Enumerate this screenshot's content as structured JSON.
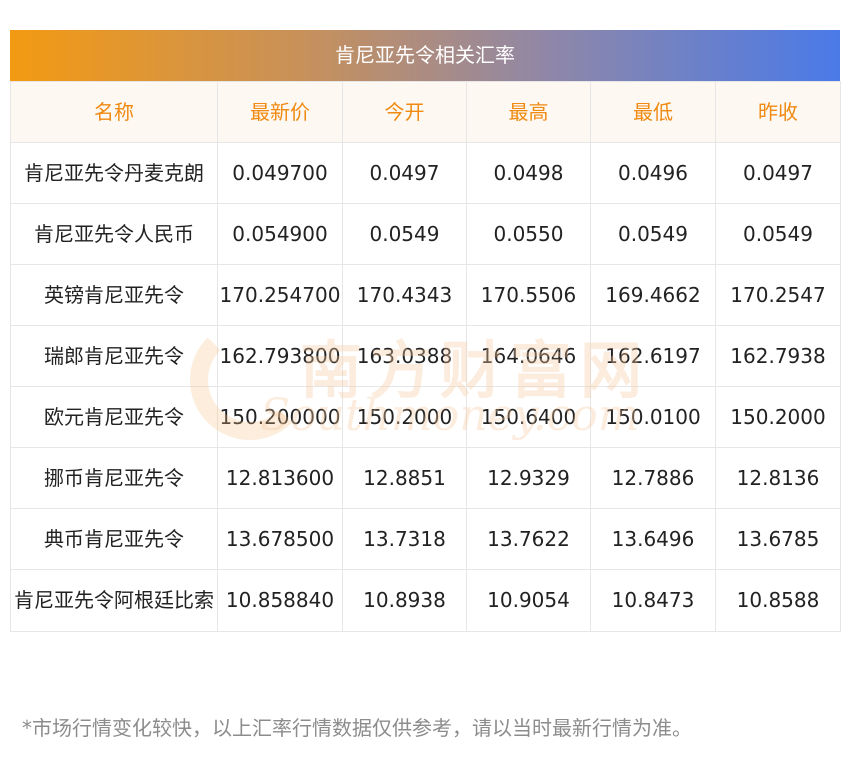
{
  "title": "肯尼亚先令相关汇率",
  "headers": [
    "名称",
    "最新价",
    "今开",
    "最高",
    "最低",
    "昨收"
  ],
  "rows": [
    {
      "name": "肯尼亚先令丹麦克朗",
      "latest": "0.049700",
      "open": "0.0497",
      "high": "0.0498",
      "low": "0.0496",
      "prev": "0.0497"
    },
    {
      "name": "肯尼亚先令人民币",
      "latest": "0.054900",
      "open": "0.0549",
      "high": "0.0550",
      "low": "0.0549",
      "prev": "0.0549"
    },
    {
      "name": "英镑肯尼亚先令",
      "latest": "170.254700",
      "open": "170.4343",
      "high": "170.5506",
      "low": "169.4662",
      "prev": "170.2547"
    },
    {
      "name": "瑞郎肯尼亚先令",
      "latest": "162.793800",
      "open": "163.0388",
      "high": "164.0646",
      "low": "162.6197",
      "prev": "162.7938"
    },
    {
      "name": "欧元肯尼亚先令",
      "latest": "150.200000",
      "open": "150.2000",
      "high": "150.6400",
      "low": "150.0100",
      "prev": "150.2000"
    },
    {
      "name": "挪币肯尼亚先令",
      "latest": "12.813600",
      "open": "12.8851",
      "high": "12.9329",
      "low": "12.7886",
      "prev": "12.8136"
    },
    {
      "name": "典币肯尼亚先令",
      "latest": "13.678500",
      "open": "13.7318",
      "high": "13.7622",
      "low": "13.6496",
      "prev": "13.6785"
    },
    {
      "name": "肯尼亚先令阿根廷比索",
      "latest": "10.858840",
      "open": "10.8938",
      "high": "10.9054",
      "low": "10.8473",
      "prev": "10.8588"
    }
  ],
  "note": "*市场行情变化较快，以上汇率行情数据仅供参考，请以当时最新行情为准。",
  "watermark": {
    "cn": "南方财富网",
    "en": "Southmoney.com"
  },
  "colors": {
    "header_text": "#f08a12",
    "gradient_start": "#f39a12",
    "gradient_end": "#4a7ae8"
  }
}
